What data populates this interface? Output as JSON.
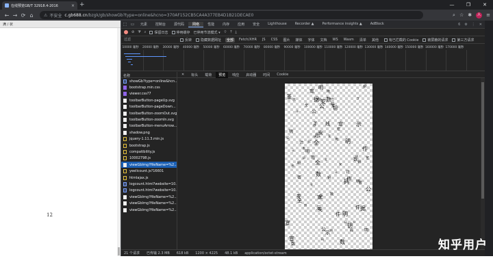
{
  "browser": {
    "tab_title": "在线预览GB/T 32918.4-2016",
    "new_tab": "+",
    "close_tab": "×",
    "window_buttons": [
      "—",
      "❐",
      "✕"
    ],
    "nav": {
      "back": "←",
      "forward": "→",
      "reload": "⟳",
      "home": "⌂"
    },
    "url": {
      "security": "不安全",
      "host": "c.gb688.cn",
      "path": "/bzgk/gb/showGb?type=online&hcno=370AF152CB5CA4A377EB4D1B21DECAE0"
    },
    "right_icons": [
      "⌕",
      "☆",
      "✱",
      "≡"
    ],
    "avatar": "人"
  },
  "page": {
    "zoom_label": "满 / 状",
    "page_number": "12"
  },
  "devtools": {
    "tabs": [
      "元素",
      "控制台",
      "源代码",
      "网络",
      "性能",
      "内存",
      "应用",
      "安全",
      "Lighthouse",
      "Recorder ▲",
      "Performance insights ▲",
      "AdBlock"
    ],
    "active_tab": "网络",
    "right_badge": "6",
    "toolbar": {
      "preserve_log": "保留日志",
      "disable_cache": "停用缓存",
      "throttle": "已停用节流模式 ▾"
    },
    "filter": {
      "placeholder": "过滤",
      "invert": "反转",
      "hide_data_urls": "隐藏数据网址",
      "types": [
        "全部",
        "Fetch/XHR",
        "JS",
        "CSS",
        "图片",
        "媒体",
        "字体",
        "文档",
        "WS",
        "Wasm",
        "清单",
        "其他"
      ],
      "active_type": "全部",
      "blocked_cookies": "有已拦截的 Cookie",
      "blocked_requests": "被屏蔽的请求",
      "third_party": "第三方请求"
    },
    "timeline_ticks": [
      "10000 毫秒",
      "20000 毫秒",
      "30000 毫秒",
      "40000 毫秒",
      "50000 毫秒",
      "60000 毫秒",
      "70000 毫秒",
      "80000 毫秒",
      "90000 毫秒",
      "100000 毫秒",
      "110000 毫秒",
      "120000 毫秒",
      "130000 毫秒",
      "140000 毫秒",
      "150000 毫秒",
      "160000 毫秒",
      "170000 毫秒"
    ],
    "names_header": "名称",
    "requests": [
      {
        "name": "showGb?type=online&hcn...",
        "kind": "doc"
      },
      {
        "name": "bootstrap.min.css",
        "kind": "css"
      },
      {
        "name": "viewer.css?7",
        "kind": "css"
      },
      {
        "name": "toolbarButton-pageUp.svg",
        "kind": "img"
      },
      {
        "name": "toolbarButton-pageDown...",
        "kind": "img"
      },
      {
        "name": "toolbarButton-zoomOut.svg",
        "kind": "img"
      },
      {
        "name": "toolbarButton-zoomIn.svg",
        "kind": "img"
      },
      {
        "name": "toolbarButton-menuArrow...",
        "kind": "img"
      },
      {
        "name": "shadow.png",
        "kind": "img"
      },
      {
        "name": "jquery-1.11.3.min.js",
        "kind": "js"
      },
      {
        "name": "bootstrap.js",
        "kind": "js"
      },
      {
        "name": "compatibility.js",
        "kind": "js"
      },
      {
        "name": "10002798.js",
        "kind": "js"
      },
      {
        "name": "viewGbImg?fileName=%2...",
        "kind": "img",
        "selected": true
      },
      {
        "name": "yeelicount.js?16601",
        "kind": "js"
      },
      {
        "name": "htmlajax.js",
        "kind": "js"
      },
      {
        "name": "logcount.html?website=10...",
        "kind": "doc"
      },
      {
        "name": "logcount.html?website=10...",
        "kind": "doc"
      },
      {
        "name": "viewGbImg?fileName=%2...",
        "kind": "img"
      },
      {
        "name": "viewGbImg?fileName=%2...",
        "kind": "img"
      },
      {
        "name": "viewGbImg?fileName=%2...",
        "kind": "img"
      }
    ],
    "detail_tabs": [
      "标头",
      "载荷",
      "预览",
      "响应",
      "启动器",
      "时间",
      "Cookie"
    ],
    "active_detail_tab": "预览",
    "status": {
      "requests": "21 个请求",
      "transferred": "已传输 2.3 MB",
      "size": "618 kB",
      "dimensions": "1200 × 4225",
      "type_size": "48.1 kB",
      "mime": "application/octet-stream"
    }
  },
  "watermark": "知乎用户",
  "preview_glyphs": [
    "全",
    "字",
    "码",
    "宣",
    "钥",
    "签",
    "据",
    "数",
    "明",
    "公",
    "安",
    "示",
    "密",
    "线",
    "计",
    "作",
    "件",
    "用"
  ],
  "colors": {
    "devtools_bg": "#242424",
    "selection": "#1a5fb4",
    "accent": "#8ab4f8",
    "record": "#f28b82"
  }
}
